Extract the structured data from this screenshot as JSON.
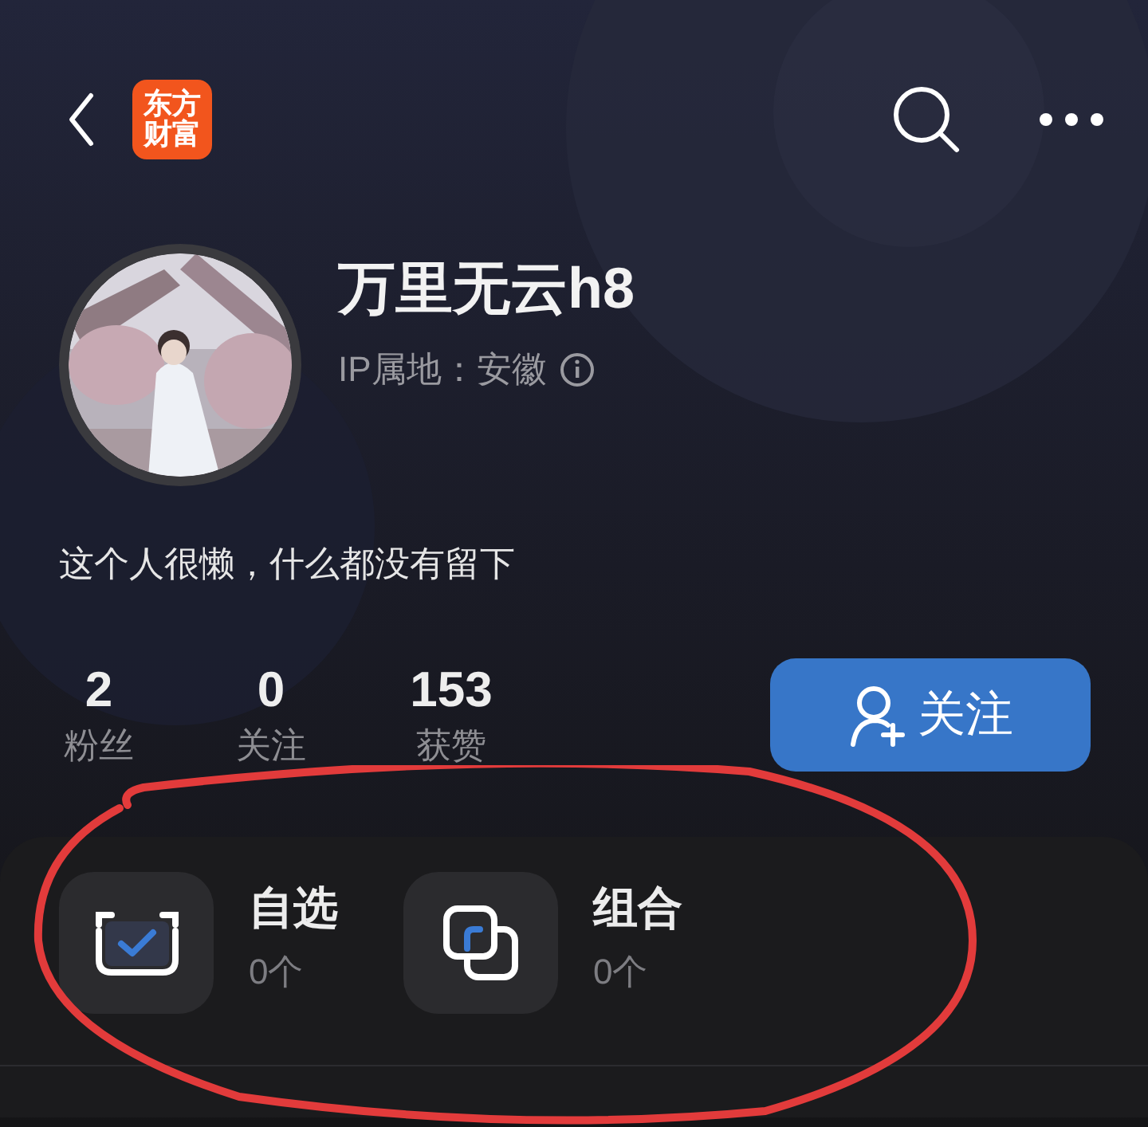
{
  "top_bar": {
    "logo": {
      "line1": "东方",
      "line2": "财富"
    }
  },
  "profile": {
    "name": "万里无云h8",
    "ip_location": "IP属地：安徽",
    "bio": "这个人很懒，什么都没有留下"
  },
  "stats": [
    {
      "value": "2",
      "label": "粉丝"
    },
    {
      "value": "0",
      "label": "关注"
    },
    {
      "value": "153",
      "label": "获赞"
    }
  ],
  "follow_button": {
    "label": "关注"
  },
  "assets": [
    {
      "kind": "watchlist",
      "title": "自选",
      "count": "0个"
    },
    {
      "kind": "portfolio",
      "title": "组合",
      "count": "0个"
    }
  ],
  "annotation": {
    "kind": "ellipse"
  }
}
